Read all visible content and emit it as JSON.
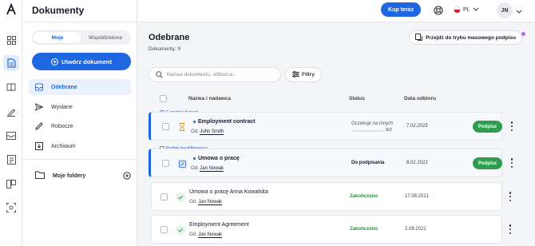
{
  "header": {
    "app_title": "Dokumenty",
    "buy_label": "Kup teraz",
    "language": "PL",
    "user_initials": "JN"
  },
  "sidebar": {
    "segments": [
      {
        "label": "Moje",
        "active": true
      },
      {
        "label": "Współdzielone",
        "active": false
      }
    ],
    "create_label": "Utwórz dokument",
    "items": [
      {
        "label": "Odebrane",
        "icon": "inbox-icon",
        "active": true
      },
      {
        "label": "Wysłane",
        "icon": "send-icon",
        "active": false
      },
      {
        "label": "Robocze",
        "icon": "pencil-icon",
        "active": false
      },
      {
        "label": "Archiwum",
        "icon": "archive-icon",
        "active": false
      }
    ],
    "folders_label": "Moje foldery"
  },
  "rail": {
    "icons": [
      "logo-icon",
      "grid-icon",
      "documents-icon",
      "book-icon",
      "signature-icon",
      "mail-icon",
      "contacts-icon",
      "templates-icon",
      "scan-icon"
    ]
  },
  "main": {
    "title": "Odebrane",
    "doc_count": "Dokumenty: 9",
    "bulk_label": "Przejdź do trybu masowego podpisu",
    "search_placeholder": "Nazwa dokumentu, odbiorca...",
    "filters_label": "Filtry",
    "columns": {
      "name": "Nazwa i nadawca",
      "status": "Status",
      "date": "Data odbioru"
    },
    "rows": [
      {
        "tag": "E-podpis Autenti",
        "name": "Employment contract",
        "from_prefix": "Od:",
        "from": "John Smith",
        "status": "Oczekuje na innych",
        "progress": "0/2",
        "progress_fraction": 0,
        "date": "7.02.2025",
        "action": "Podpisz",
        "status_icon": "hourglass-icon",
        "unread": true
      },
      {
        "tag": "Podpis kwalifikowany",
        "name": "Umowa o pracę",
        "from_prefix": "Od:",
        "from": "Jan Nowak",
        "status": "Do podpisania",
        "date": "8.02.2022",
        "action": "Podpisz",
        "status_icon": "edit-icon",
        "unread": true
      },
      {
        "name": "Umowa o pracę Anna Kowalska",
        "from_prefix": "Od:",
        "from": "Jan Nowak",
        "status": "Zakończono",
        "date": "17.08.2021",
        "status_icon": "check-circle-icon"
      },
      {
        "name": "Employment Agreement",
        "from_prefix": "Od:",
        "from": "Jan Nowak",
        "status": "Zakończono",
        "date": "2.08.2021",
        "status_icon": "check-circle-icon"
      }
    ]
  },
  "colors": {
    "accent": "#1f67e0",
    "success": "#2e9d4f",
    "completed_text": "#2e8a44"
  }
}
